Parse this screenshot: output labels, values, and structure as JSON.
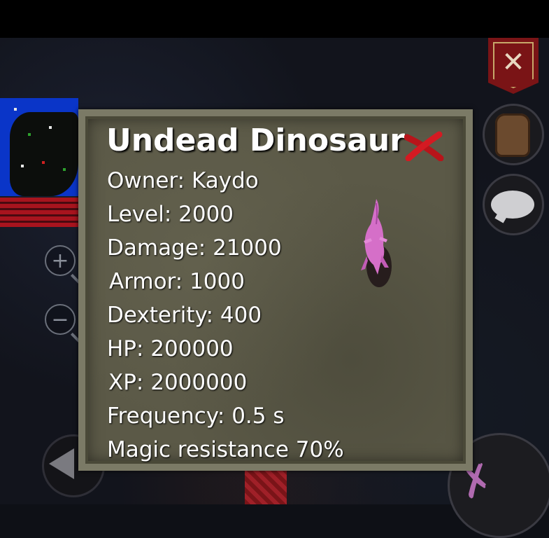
{
  "title": "Undead Dinosaur",
  "stats": [
    "Owner: Kaydo",
    "Level: 2000",
    "Damage: 21000",
    "Armor: 1000",
    "Dexterity: 400",
    "HP: 200000",
    "XP: 2000000",
    "Frequency: 0.5 s",
    "Magic resistance 70%"
  ],
  "icons": {
    "close": "close-icon",
    "zoom_in": "zoom-in-icon",
    "zoom_out": "zoom-out-icon",
    "guild_banner": "crossed-swords-banner-icon",
    "inventory": "backpack-icon",
    "chat": "chat-bubble-icon",
    "attack": "crossbow-icon",
    "back": "back-arrow-icon"
  },
  "colors": {
    "panel_bg": "#5b5947",
    "panel_border": "#7b7a66",
    "text": "#ffffff",
    "close_red": "#c8141c",
    "creature": "#d56fc8"
  }
}
